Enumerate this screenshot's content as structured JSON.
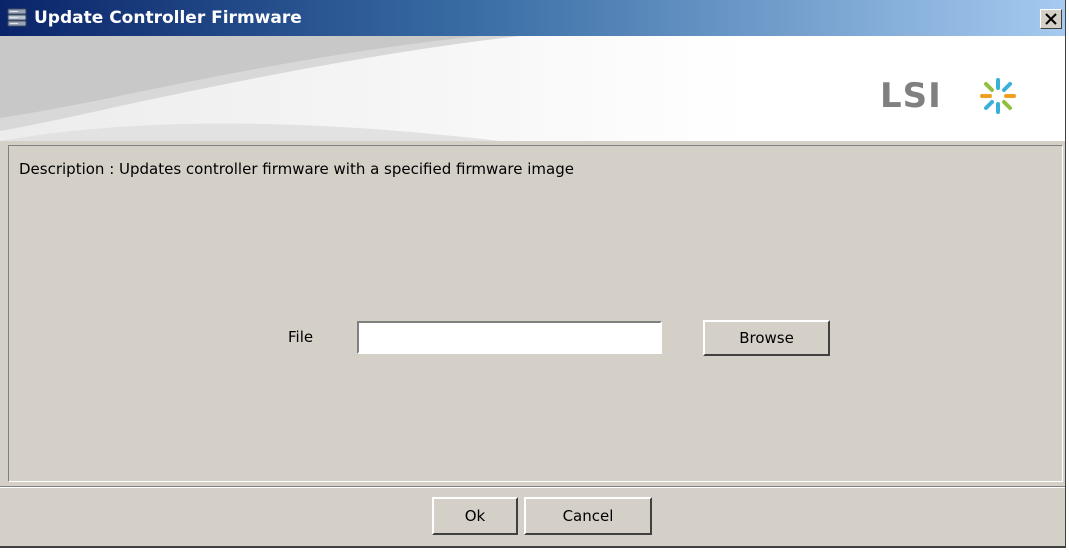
{
  "window": {
    "title": "Update Controller Firmware",
    "title_icon": "database-icon",
    "close_icon": "close-icon"
  },
  "banner": {
    "logo_text": "LSI",
    "logo_mark": "lsi-starburst-icon",
    "logo_mark_color": "#3ab0d8"
  },
  "content": {
    "description": "Description : Updates controller firmware with a specified firmware image",
    "file_label": "File",
    "file_value": "",
    "browse_label": "Browse"
  },
  "footer": {
    "ok_label": "Ok",
    "cancel_label": "Cancel"
  },
  "colors": {
    "titlebar_start": "#0a246a",
    "titlebar_end": "#a6caf0",
    "dialog_bg": "#d4d0c8"
  }
}
